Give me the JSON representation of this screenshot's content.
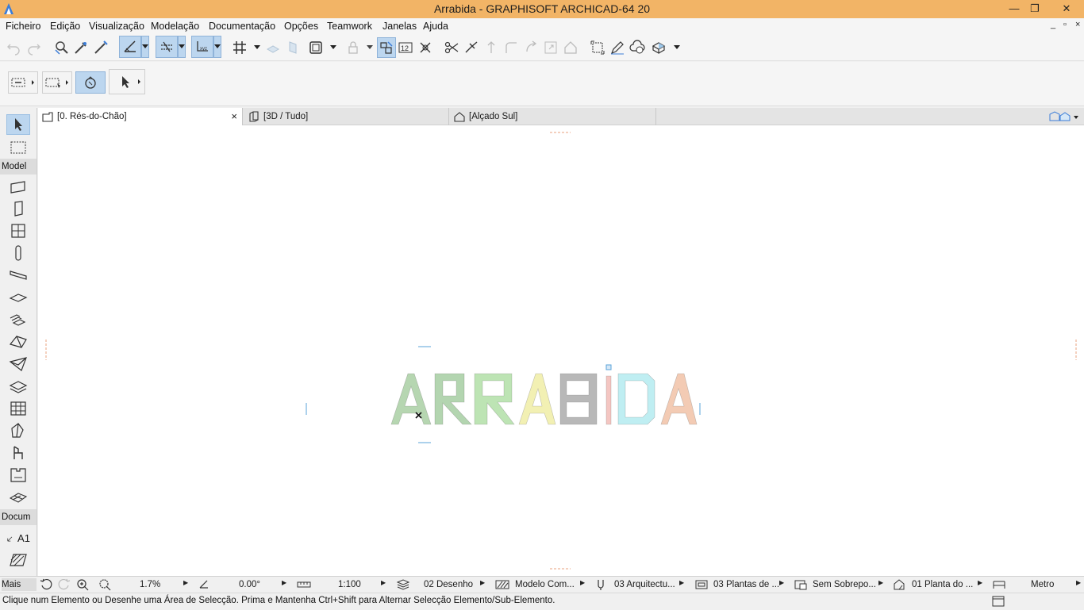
{
  "window": {
    "title": "Arrabida - GRAPHISOFT ARCHICAD-64 20",
    "minimize_label": "—",
    "restore_label": "❐",
    "close_label": "✕"
  },
  "menubar": {
    "items": [
      "Ficheiro",
      "Edição",
      "Visualização",
      "Modelação",
      "Documentação",
      "Opções",
      "Teamwork",
      "Janelas",
      "Ajuda"
    ],
    "mdi": [
      "_",
      "▫",
      "×"
    ]
  },
  "tabs": [
    {
      "label": "[0. Rés-do-Chão]",
      "icon": "floor-plan-icon",
      "close": "×"
    },
    {
      "label": "[3D / Tudo]",
      "icon": "3d-view-icon"
    },
    {
      "label": "[Alçado Sul]",
      "icon": "elevation-icon"
    }
  ],
  "toolbox": {
    "section_model": "Model",
    "section_doc": "Docum",
    "more_label": "Mais",
    "dimension_label": "A1"
  },
  "canvas": {
    "text": "ARRABIDA",
    "letter_colors": [
      "#b6d6b1",
      "#b3d5b0",
      "#bde4b4",
      "#f2f0b3",
      "#b8b8b8",
      "#f4c6c2",
      "#bfeef2",
      "#f3cbb4"
    ],
    "accent_color": "#5aa3d8",
    "marker_color": "#e8a27e"
  },
  "quick_options": {
    "zoom": "1.7%",
    "angle": "0.00°",
    "scale": "1:100",
    "layer": "02 Desenho",
    "model_view": "Modelo Com...",
    "pen_set": "03 Arquitectu...",
    "mvo": "03 Plantas de ...",
    "override": "Sem Sobrepo...",
    "renovation": "01 Planta do ...",
    "dimension": "Metro"
  },
  "status": {
    "text": "Clique num Elemento ou Desenhe uma Área de Selecção. Prima e Mantenha Ctrl+Shift para Alternar Selecção Elemento/Sub-Elemento."
  }
}
